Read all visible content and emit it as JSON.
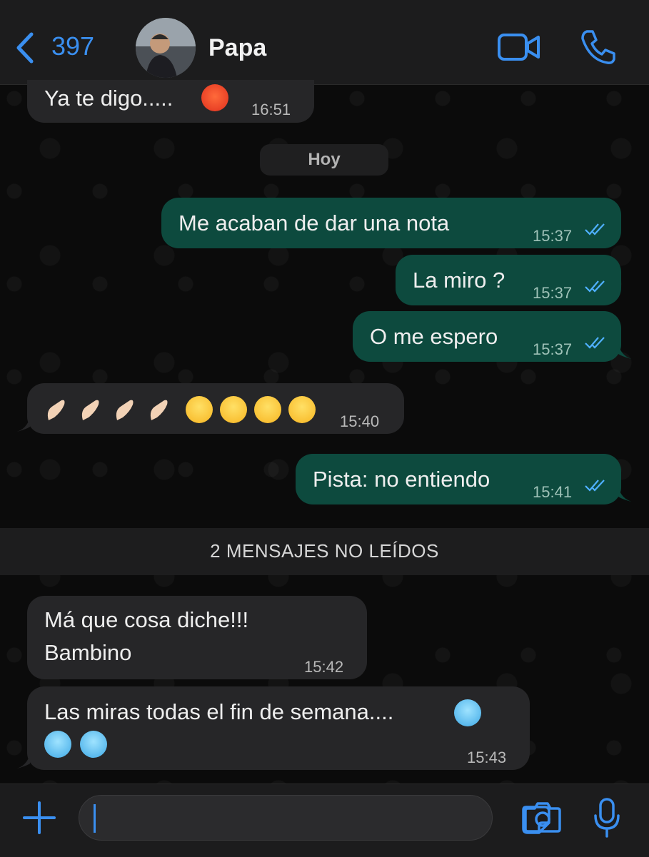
{
  "header": {
    "back_count": "397",
    "contact_name": "Papa",
    "icons": [
      "chevron-left-icon",
      "video-call-icon",
      "phone-icon"
    ]
  },
  "day_separator": "Hoy",
  "unread_banner": "2 MENSAJES NO LEÍDOS",
  "messages": [
    {
      "direction": "in",
      "text": "Ya te digo.....",
      "emoji": [
        "angry-face"
      ],
      "time": "16:51"
    },
    {
      "direction": "out",
      "text": "Me acaban de dar una nota",
      "time": "15:37",
      "status": "read"
    },
    {
      "direction": "out",
      "text": "La miro ?",
      "time": "15:37",
      "status": "read"
    },
    {
      "direction": "out",
      "text": "O me espero",
      "time": "15:37",
      "status": "read"
    },
    {
      "direction": "in",
      "text": "",
      "emoji": [
        "pinched-fingers",
        "pinched-fingers",
        "pinched-fingers",
        "pinched-fingers",
        "grinning-face",
        "grinning-face",
        "grinning-face",
        "grinning-face"
      ],
      "time": "15:40"
    },
    {
      "direction": "out",
      "text": "Pista: no entiendo",
      "time": "15:41",
      "status": "read"
    },
    {
      "direction": "in",
      "text_lines": [
        "Má que cosa diche!!!",
        "Bambino"
      ],
      "time": "15:42"
    },
    {
      "direction": "in",
      "text": "Las miras todas el fin de semana....",
      "emoji": [
        "cold-face",
        "cold-face",
        "cold-face"
      ],
      "time": "15:43"
    }
  ],
  "input_bar": {
    "placeholder": "",
    "icons": [
      "plus-icon",
      "sticker-icon",
      "camera-icon",
      "microphone-icon"
    ]
  },
  "colors": {
    "accent": "#3a8ff0",
    "outgoing_bubble": "#0d4a3e",
    "incoming_bubble": "#262628",
    "background": "#0b0b0b"
  }
}
